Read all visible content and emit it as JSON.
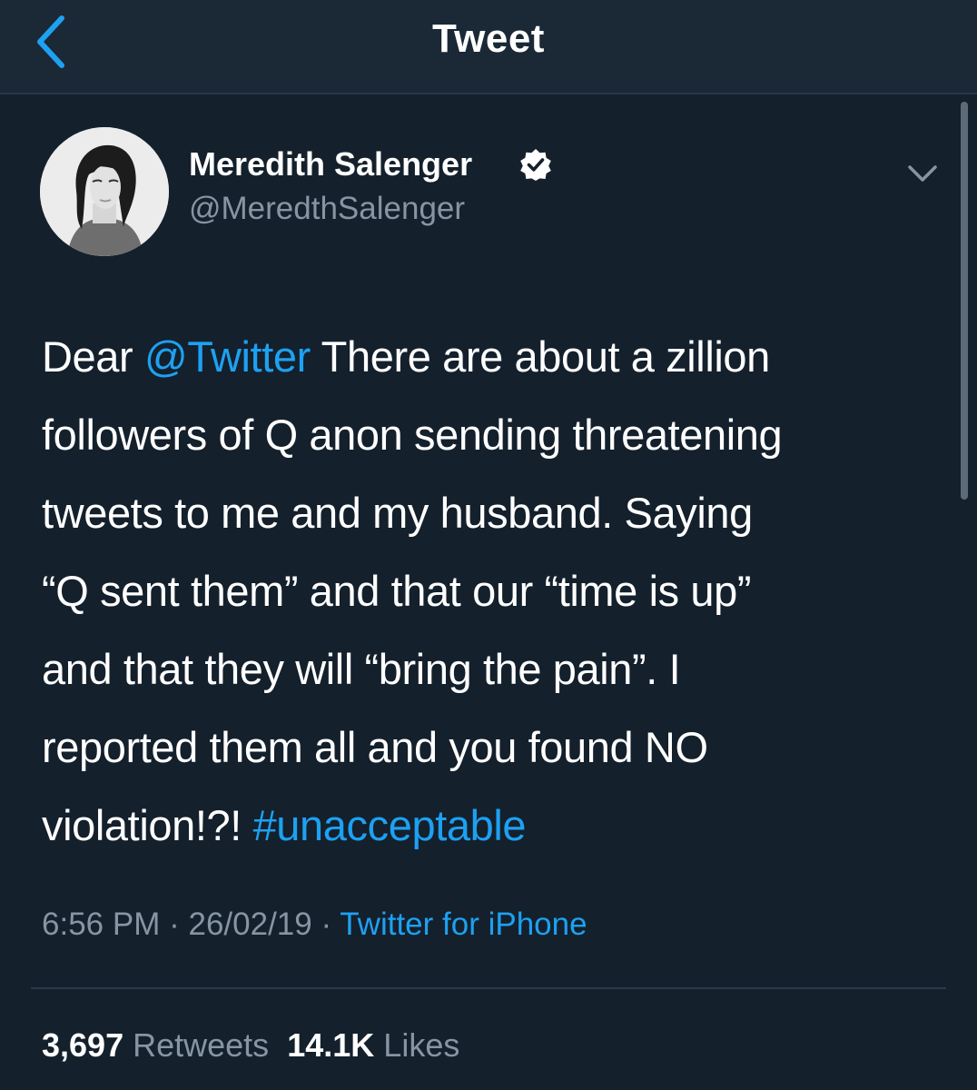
{
  "nav": {
    "title": "Tweet",
    "back_icon": "chevron-left-icon"
  },
  "colors": {
    "background": "#14202c",
    "nav_background": "#1b2836",
    "link": "#1da1f2",
    "secondary_text": "#8795a3"
  },
  "tweet": {
    "author": {
      "name": "Meredith Salenger",
      "handle": "@MeredthSalenger",
      "verified_icon": "verified-badge-icon",
      "avatar": "avatar-photo"
    },
    "menu_icon": "chevron-down-icon",
    "text": {
      "l1_a": "Dear ",
      "mention": "@Twitter",
      "l1_b": " There are about a zillion",
      "l2": "followers of Q anon sending threatening",
      "l3": "tweets to me and my husband.  Saying",
      "l4": "“Q sent them” and that our “time is up”",
      "l5": "and that they will “bring the pain”. I",
      "l6": "reported them all and you found NO",
      "l7_a": "violation!?! ",
      "hashtag": "#unacceptable"
    },
    "time": "6:56 PM",
    "sep": "·",
    "date": "26/02/19",
    "source": "Twitter for iPhone"
  },
  "stats": {
    "retweets_count": "3,697",
    "retweets_label": "Retweets",
    "likes_count": "14.1K",
    "likes_label": "Likes"
  }
}
